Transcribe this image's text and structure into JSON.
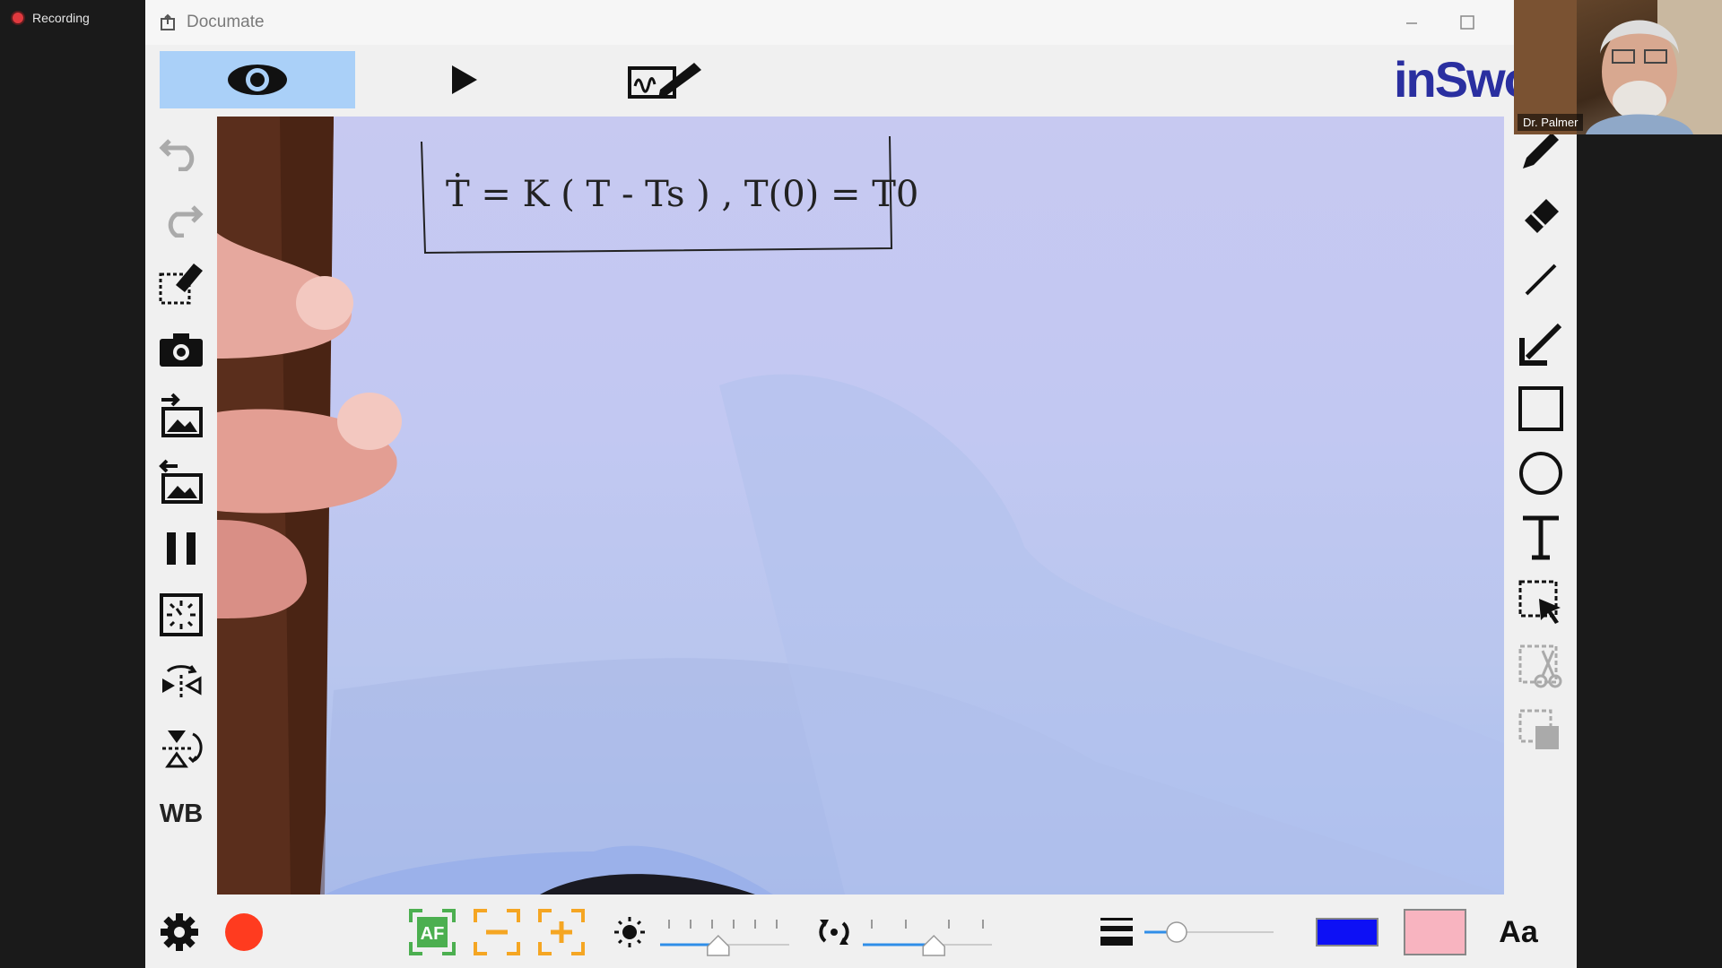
{
  "recording": {
    "label": "Recording",
    "color": "#e0393e"
  },
  "window": {
    "title": "Documate",
    "minimize_icon": "minimize-icon",
    "maximize_icon": "maximize-icon"
  },
  "toolbar": {
    "modes": [
      "live-view-eye-icon",
      "play-icon",
      "annotate-pen-icon"
    ],
    "active_mode": "live-view",
    "brand": "inSwo"
  },
  "left_tools": [
    "undo",
    "redo",
    "clear-drawing",
    "capture-camera",
    "import-image",
    "export-image",
    "pause",
    "freeze-timer",
    "flip",
    "rotate",
    "white-balance"
  ],
  "left_tools_wb_label": "WB",
  "right_tools": [
    "pen",
    "eraser",
    "line",
    "arrow",
    "rectangle",
    "ellipse",
    "text",
    "select",
    "cut",
    "copy"
  ],
  "canvas": {
    "equation": "Ṫ = K ( T - Ts ) , T(0) = T0"
  },
  "bottom": {
    "af_label": "AF",
    "font_label": "Aa",
    "brightness_level": 0.45,
    "rotation_level": 0.55,
    "line_width_level": 0.25,
    "pen_color": "#0d10f5",
    "fill_color": "#f8b4c0",
    "record_color": "#ff3b1f"
  },
  "webcam": {
    "name": "Dr. Palmer"
  }
}
